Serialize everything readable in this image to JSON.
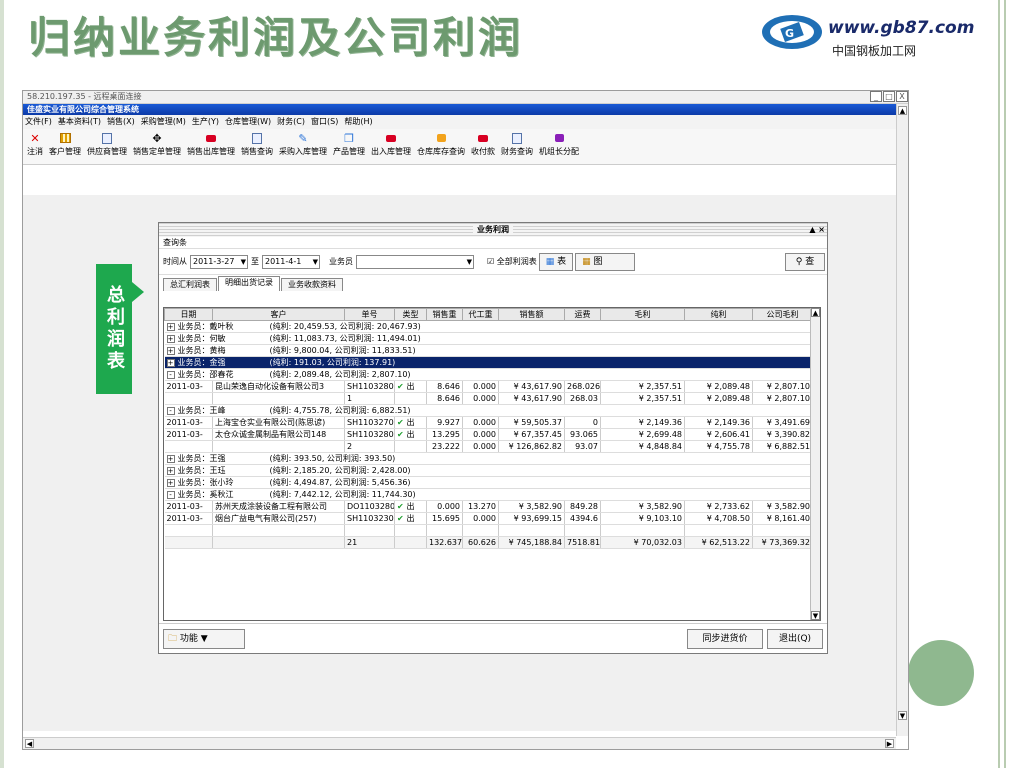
{
  "slide": {
    "title": "归纳业务利润及公司利润",
    "logo_url": "www.gb87.com",
    "logo_cn": "中国钢板加工网"
  },
  "remote": {
    "title": "58.210.197.35 - 远程桌面连接",
    "min": "_",
    "max": "□",
    "close": "X"
  },
  "app": {
    "title": "佳盛实业有限公司综合管理系统",
    "menu": [
      "文件(F)",
      "基本资料(T)",
      "销售(X)",
      "采购管理(M)",
      "生产(Y)",
      "仓库管理(W)",
      "财务(C)",
      "窗口(S)",
      "帮助(H)"
    ],
    "toolbar": [
      {
        "label": "注消",
        "icon": "close-x-icon"
      },
      {
        "label": "客户管理",
        "icon": "grid-icon"
      },
      {
        "label": "供应商管理",
        "icon": "doc-icon"
      },
      {
        "label": "销售定单管理",
        "icon": "move-icon"
      },
      {
        "label": "销售出库管理",
        "icon": "red-box-icon"
      },
      {
        "label": "销售查询",
        "icon": "doc-icon"
      },
      {
        "label": "采购入库管理",
        "icon": "pen-icon"
      },
      {
        "label": "产品管理",
        "icon": "box-icon"
      },
      {
        "label": "出入库管理",
        "icon": "red-box-icon"
      },
      {
        "label": "仓库库存查询",
        "icon": "orange-box-icon"
      },
      {
        "label": "收付款",
        "icon": "red-box-icon"
      },
      {
        "label": "财务查询",
        "icon": "doc-icon"
      },
      {
        "label": "机组长分配",
        "icon": "purple-box-icon"
      }
    ]
  },
  "side_label": "总利润表",
  "dialog": {
    "title": "业务利润",
    "ctrl": "▲ ×",
    "query_label": "查询条",
    "from_label": "时间从",
    "from_value": "2011-3-27",
    "to_label": "至",
    "to_value": "2011-4-1",
    "salesman_label": "业务员",
    "all_profit_label": "全部利润表",
    "table_btn": "表",
    "chart_btn": "图",
    "search_btn": "查",
    "tabs": [
      "总汇利润表",
      "明细出货记录",
      "业务收款资料"
    ],
    "columns": [
      "日期",
      "客户",
      "单号",
      "类型",
      "销售重",
      "代工重",
      "销售额",
      "运费",
      "毛利",
      "纯利",
      "公司毛利"
    ],
    "func_btn": "功能",
    "sync_btn": "同步进货价",
    "exit_btn": "退出(Q)"
  },
  "rows": [
    {
      "kind": "group",
      "sign": "+",
      "text": "业务员：戴叶秋",
      "profit": "(纯利: 20,459.53, 公司利润: 20,467.93)"
    },
    {
      "kind": "group",
      "sign": "+",
      "text": "业务员：何敏",
      "profit": "(纯利: 11,083.73, 公司利润: 11,494.01)"
    },
    {
      "kind": "group",
      "sign": "+",
      "text": "业务员：黄梅",
      "profit": "(纯利: 9,800.04, 公司利润: 11,833.51)"
    },
    {
      "kind": "group",
      "sign": "+",
      "text": "业务员：金强",
      "profit": "(纯利: 191.03, 公司利润: 137.91)",
      "selected": true
    },
    {
      "kind": "group",
      "sign": "-",
      "text": "业务员：邵春花",
      "profit": "(纯利: 2,089.48, 公司利润: 2,807.10)"
    },
    {
      "kind": "data",
      "date": "2011-03-",
      "cust": "昆山荣逸自动化设备有限公司3",
      "no": "SH11032800",
      "type": "出",
      "sw": "8.646",
      "dw": "0.000",
      "amt": "¥ 43,617.90",
      "fee": "268.026",
      "gp": "¥ 2,357.51",
      "np": "¥ 2,089.48",
      "cp": "¥ 2,807.10"
    },
    {
      "kind": "sub",
      "no": "1",
      "sw": "8.646",
      "dw": "0.000",
      "amt": "¥ 43,617.90",
      "fee": "268.03",
      "gp": "¥ 2,357.51",
      "np": "¥ 2,089.48",
      "cp": "¥ 2,807.10"
    },
    {
      "kind": "group",
      "sign": "-",
      "text": "业务员：王峰",
      "profit": "(纯利: 4,755.78, 公司利润: 6,882.51)"
    },
    {
      "kind": "data",
      "date": "2011-03-",
      "cust": "上海宝仓实业有限公司(陈思谚)",
      "no": "SH11032700",
      "type": "出",
      "sw": "9.927",
      "dw": "0.000",
      "amt": "¥ 59,505.37",
      "fee": "0",
      "gp": "¥ 2,149.36",
      "np": "¥ 2,149.36",
      "cp": "¥ 3,491.69"
    },
    {
      "kind": "data",
      "date": "2011-03-",
      "cust": "太仓众诚金属制品有限公司148",
      "no": "SH11032800",
      "type": "出",
      "sw": "13.295",
      "dw": "0.000",
      "amt": "¥ 67,357.45",
      "fee": "93.065",
      "gp": "¥ 2,699.48",
      "np": "¥ 2,606.41",
      "cp": "¥ 3,390.82"
    },
    {
      "kind": "sub",
      "no": "2",
      "sw": "23.222",
      "dw": "0.000",
      "amt": "¥ 126,862.82",
      "fee": "93.07",
      "gp": "¥ 4,848.84",
      "np": "¥ 4,755.78",
      "cp": "¥ 6,882.51"
    },
    {
      "kind": "group",
      "sign": "+",
      "text": "业务员：王强",
      "profit": "(纯利: 393.50, 公司利润: 393.50)"
    },
    {
      "kind": "group",
      "sign": "+",
      "text": "业务员：王珏",
      "profit": "(纯利: 2,185.20, 公司利润: 2,428.00)"
    },
    {
      "kind": "group",
      "sign": "+",
      "text": "业务员：张小玲",
      "profit": "(纯利: 4,494.87, 公司利润: 5,456.36)"
    },
    {
      "kind": "group",
      "sign": "-",
      "text": "业务员：奚秋江",
      "profit": "(纯利: 7,442.12, 公司利润: 11,744.30)"
    },
    {
      "kind": "data",
      "date": "2011-03-",
      "cust": "苏州天成涂装设备工程有限公司",
      "no": "DO11032800",
      "type": "出",
      "sw": "0.000",
      "dw": "13.270",
      "amt": "¥ 3,582.90",
      "fee": "849.28",
      "gp": "¥ 3,582.90",
      "np": "¥ 2,733.62",
      "cp": "¥ 3,582.90"
    },
    {
      "kind": "data",
      "date": "2011-03-",
      "cust": "烟台广益电气有限公司(257)",
      "no": "SH11032301",
      "type": "出",
      "sw": "15.695",
      "dw": "0.000",
      "amt": "¥ 93,699.15",
      "fee": "4394.6",
      "gp": "¥ 9,103.10",
      "np": "¥ 4,708.50",
      "cp": "¥ 8,161.40"
    }
  ],
  "total": {
    "no": "21",
    "sw": "132.637",
    "dw": "60.626",
    "amt": "¥ 745,188.84",
    "fee": "7518.81",
    "gp": "¥ 70,032.03",
    "np": "¥ 62,513.22",
    "cp": "¥ 73,369.32"
  },
  "colors": {
    "accent_green": "#1ea84e",
    "title_green": "#6d9a6f",
    "selection": "#0a246a"
  }
}
